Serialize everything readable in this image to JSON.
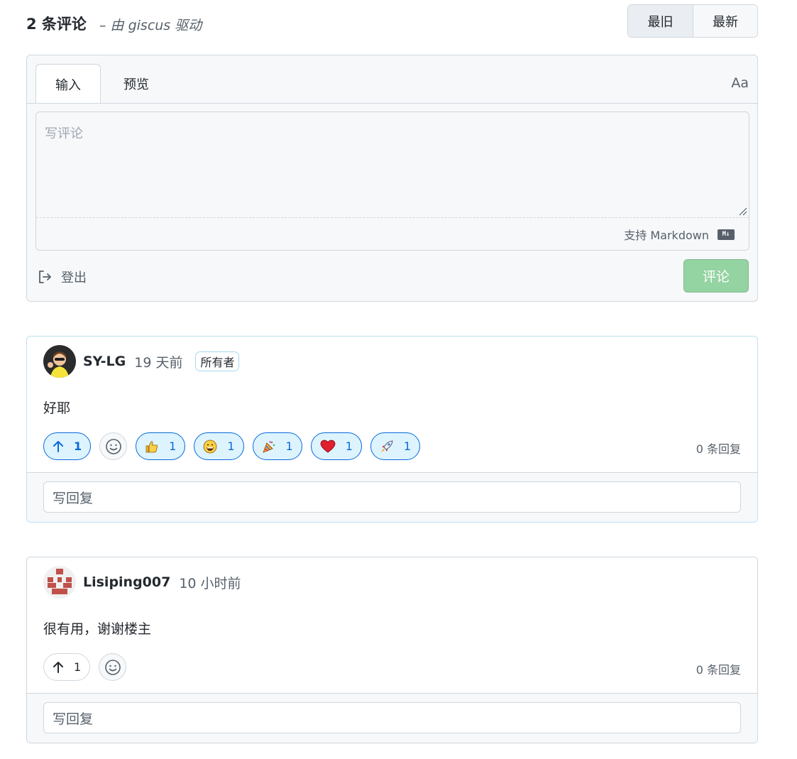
{
  "header": {
    "count": "2 条评论",
    "powered_by": "– 由 giscus 驱动",
    "sort": {
      "oldest": "最旧",
      "newest": "最新"
    }
  },
  "composer": {
    "tab_write": "输入",
    "tab_preview": "预览",
    "font_toggle": "Aa",
    "placeholder": "写评论",
    "markdown_note": "支持 Markdown",
    "md_badge": "M↓",
    "logout": "登出",
    "submit": "评论"
  },
  "comments": [
    {
      "author": "SY-LG",
      "time": "19 天前",
      "badge": "所有者",
      "body": "好耶",
      "upvotes": "1",
      "reactions": [
        {
          "icon": "thumbs-up-icon",
          "count": "1"
        },
        {
          "icon": "laugh-icon",
          "count": "1"
        },
        {
          "icon": "party-popper-icon",
          "count": "1"
        },
        {
          "icon": "heart-icon",
          "count": "1"
        },
        {
          "icon": "rocket-icon",
          "count": "1"
        }
      ],
      "replies": "0 条回复",
      "reply_placeholder": "写回复"
    },
    {
      "author": "Lisiping007",
      "time": "10 小时前",
      "body": "很有用，谢谢楼主",
      "upvotes": "1",
      "replies": "0 条回复",
      "reply_placeholder": "写回复"
    }
  ],
  "colors": {
    "accent": "#0969da",
    "submit_disabled": "#94d3a2",
    "border": "#d0d7de",
    "owner_border": "#bce3f3"
  }
}
